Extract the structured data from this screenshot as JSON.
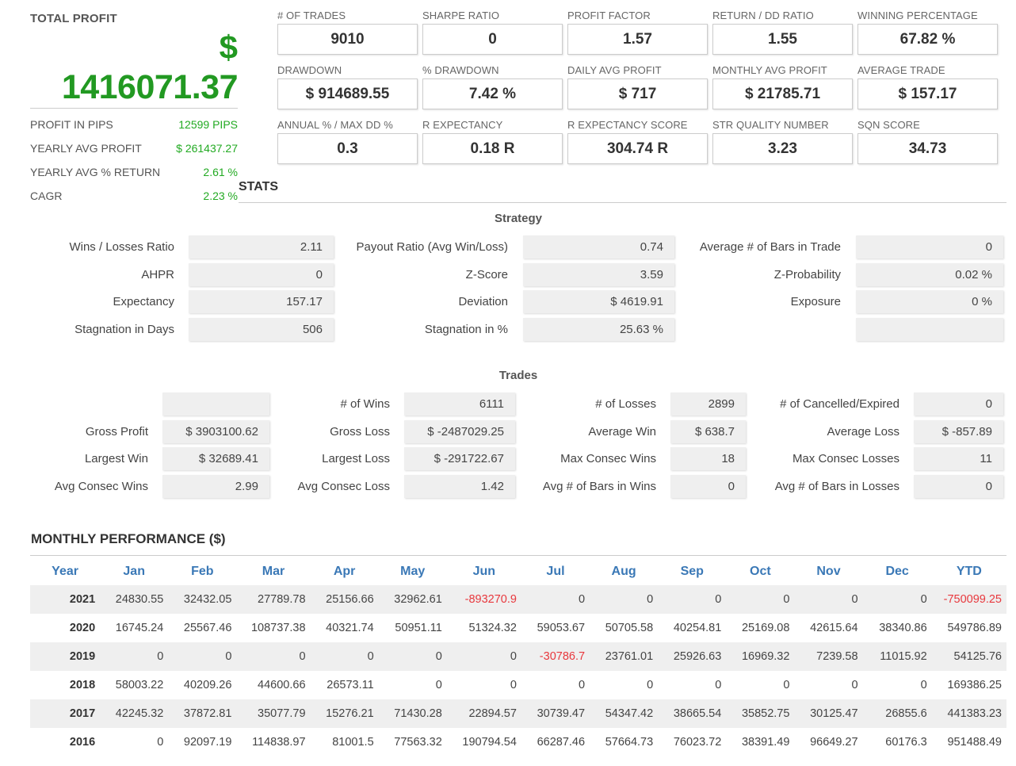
{
  "total_profit": {
    "label": "TOTAL PROFIT",
    "currency": "$",
    "amount": "1416071.37",
    "rows": [
      {
        "label": "PROFIT IN PIPS",
        "value": "12599 PIPS"
      },
      {
        "label": "YEARLY AVG PROFIT",
        "value": "$ 261437.27"
      },
      {
        "label": "YEARLY AVG % RETURN",
        "value": "2.61 %"
      },
      {
        "label": "CAGR",
        "value": "2.23 %"
      }
    ]
  },
  "kpis": [
    [
      {
        "label": "# OF TRADES",
        "value": "9010"
      },
      {
        "label": "SHARPE RATIO",
        "value": "0"
      },
      {
        "label": "PROFIT FACTOR",
        "value": "1.57"
      },
      {
        "label": "RETURN / DD RATIO",
        "value": "1.55"
      },
      {
        "label": "WINNING PERCENTAGE",
        "value": "67.82 %"
      }
    ],
    [
      {
        "label": "DRAWDOWN",
        "value": "$ 914689.55"
      },
      {
        "label": "% DRAWDOWN",
        "value": "7.42 %"
      },
      {
        "label": "DAILY AVG PROFIT",
        "value": "$ 717"
      },
      {
        "label": "MONTHLY AVG PROFIT",
        "value": "$ 21785.71"
      },
      {
        "label": "AVERAGE TRADE",
        "value": "$ 157.17"
      }
    ],
    [
      {
        "label": "ANNUAL % / MAX DD %",
        "value": "0.3"
      },
      {
        "label": "R EXPECTANCY",
        "value": "0.18 R"
      },
      {
        "label": "R EXPECTANCY SCORE",
        "value": "304.74 R"
      },
      {
        "label": "STR QUALITY NUMBER",
        "value": "3.23"
      },
      {
        "label": "SQN SCORE",
        "value": "34.73"
      }
    ]
  ],
  "stats": {
    "title": "STATS",
    "strategy": {
      "title": "Strategy",
      "rows": [
        [
          {
            "label": "Wins / Losses Ratio",
            "value": "2.11"
          },
          {
            "label": "Payout Ratio (Avg Win/Loss)",
            "value": "0.74"
          },
          {
            "label": "Average # of Bars in Trade",
            "value": "0"
          }
        ],
        [
          {
            "label": "AHPR",
            "value": "0"
          },
          {
            "label": "Z-Score",
            "value": "3.59"
          },
          {
            "label": "Z-Probability",
            "value": "0.02 %"
          }
        ],
        [
          {
            "label": "Expectancy",
            "value": "157.17"
          },
          {
            "label": "Deviation",
            "value": "$ 4619.91"
          },
          {
            "label": "Exposure",
            "value": "0 %"
          }
        ],
        [
          {
            "label": "Stagnation in Days",
            "value": "506"
          },
          {
            "label": "Stagnation in %",
            "value": "25.63 %"
          },
          {
            "label": "",
            "value": ""
          }
        ]
      ]
    },
    "trades": {
      "title": "Trades",
      "rows": [
        [
          {
            "label": "",
            "value": ""
          },
          {
            "label": "# of Wins",
            "value": "6111"
          },
          {
            "label": "# of Losses",
            "value": "2899"
          },
          {
            "label": "# of Cancelled/Expired",
            "value": "0"
          }
        ],
        [
          {
            "label": "Gross Profit",
            "value": "$ 3903100.62"
          },
          {
            "label": "Gross Loss",
            "value": "$ -2487029.25"
          },
          {
            "label": "Average Win",
            "value": "$ 638.7"
          },
          {
            "label": "Average Loss",
            "value": "$ -857.89"
          }
        ],
        [
          {
            "label": "Largest Win",
            "value": "$ 32689.41"
          },
          {
            "label": "Largest Loss",
            "value": "$ -291722.67"
          },
          {
            "label": "Max Consec Wins",
            "value": "18"
          },
          {
            "label": "Max Consec Losses",
            "value": "11"
          }
        ],
        [
          {
            "label": "Avg Consec Wins",
            "value": "2.99"
          },
          {
            "label": "Avg Consec Loss",
            "value": "1.42"
          },
          {
            "label": "Avg # of Bars in Wins",
            "value": "0"
          },
          {
            "label": "Avg # of Bars in Losses",
            "value": "0"
          }
        ]
      ]
    }
  },
  "monthly_performance": {
    "title": "MONTHLY PERFORMANCE ($)",
    "headers": [
      "Year",
      "Jan",
      "Feb",
      "Mar",
      "Apr",
      "May",
      "Jun",
      "Jul",
      "Aug",
      "Sep",
      "Oct",
      "Nov",
      "Dec",
      "YTD"
    ],
    "rows": [
      [
        "2021",
        "24830.55",
        "32432.05",
        "27789.78",
        "25156.66",
        "32962.61",
        "-893270.9",
        "0",
        "0",
        "0",
        "0",
        "0",
        "0",
        "-750099.25"
      ],
      [
        "2020",
        "16745.24",
        "25567.46",
        "108737.38",
        "40321.74",
        "50951.11",
        "51324.32",
        "59053.67",
        "50705.58",
        "40254.81",
        "25169.08",
        "42615.64",
        "38340.86",
        "549786.89"
      ],
      [
        "2019",
        "0",
        "0",
        "0",
        "0",
        "0",
        "0",
        "-30786.7",
        "23761.01",
        "25926.63",
        "16969.32",
        "7239.58",
        "11015.92",
        "54125.76"
      ],
      [
        "2018",
        "58003.22",
        "40209.26",
        "44600.66",
        "26573.11",
        "0",
        "0",
        "0",
        "0",
        "0",
        "0",
        "0",
        "0",
        "169386.25"
      ],
      [
        "2017",
        "42245.32",
        "37872.81",
        "35077.79",
        "15276.21",
        "71430.28",
        "22894.57",
        "30739.47",
        "54347.42",
        "38665.54",
        "35852.75",
        "30125.47",
        "26855.6",
        "441383.23"
      ],
      [
        "2016",
        "0",
        "92097.19",
        "114838.97",
        "81001.5",
        "77563.32",
        "190794.54",
        "66287.46",
        "57664.73",
        "76023.72",
        "38391.49",
        "96649.27",
        "60176.3",
        "951488.49"
      ]
    ]
  }
}
